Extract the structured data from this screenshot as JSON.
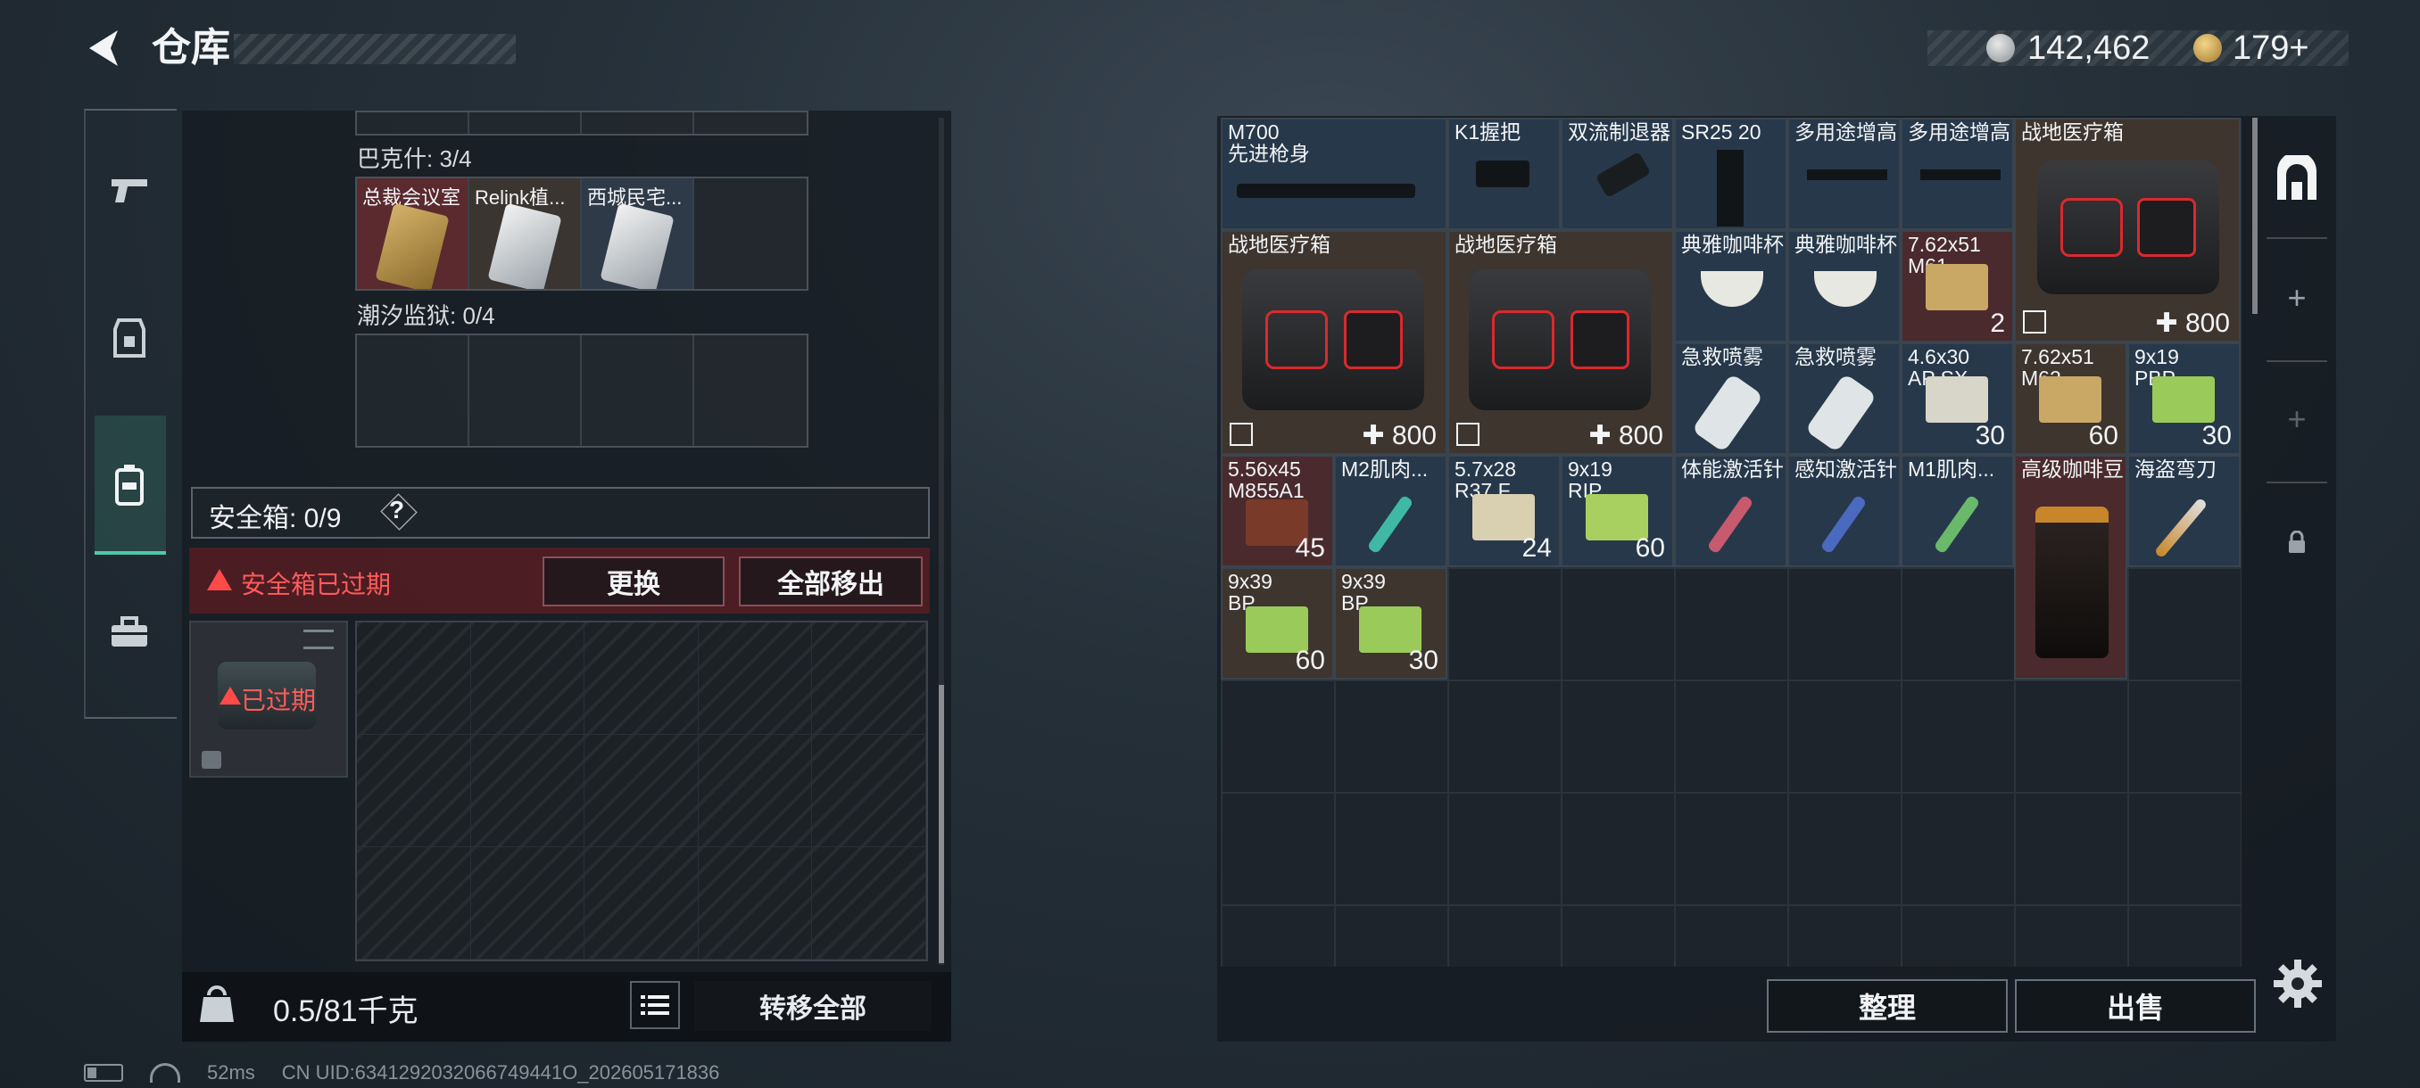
{
  "header": {
    "title": "仓库"
  },
  "currency": {
    "silver": "142,462",
    "gold": "179",
    "gold_plus": "+"
  },
  "left_panel": {
    "bakeshi_label": "巴克什: 3/4",
    "bakeshi_items": [
      "总裁会议室",
      "Relink植...",
      "西城民宅..."
    ],
    "chaoxi_label": "潮汐监狱: 0/4",
    "safe_box_label": "安全箱: 0/9",
    "help": "?",
    "expired_text": "安全箱已过期",
    "replace_btn": "更换",
    "moveall_btn": "全部移出",
    "safe_expired_label": "已过期",
    "weight": "0.5/81千克",
    "transfer_all_btn": "转移全部"
  },
  "status_bar": {
    "ping": "52ms",
    "uid": "CN UID:6341292032066749441O_202605171836"
  },
  "inventory": {
    "items": [
      {
        "name": "M700\n先进枪身"
      },
      {
        "name": "K1握把"
      },
      {
        "name": "双流制退器"
      },
      {
        "name": "SR25 20"
      },
      {
        "name": "多用途增高"
      },
      {
        "name": "多用途增高"
      },
      {
        "name": "战地医疗箱",
        "extra": "800"
      },
      {
        "name": "战地医疗箱",
        "extra": "800"
      },
      {
        "name": "战地医疗箱",
        "extra": "800"
      },
      {
        "name": "典雅咖啡杯"
      },
      {
        "name": "典雅咖啡杯"
      },
      {
        "name": "7.62x51\nM61",
        "qty": "2"
      },
      {
        "name": "急救喷雾"
      },
      {
        "name": "急救喷雾"
      },
      {
        "name": "4.6x30\nAP SX",
        "qty": "30"
      },
      {
        "name": "7.62x51\nM62",
        "qty": "60"
      },
      {
        "name": "9x19\nPBP",
        "qty": "30"
      },
      {
        "name": "5.56x45\nM855A1",
        "qty": "45"
      },
      {
        "name": "M2肌肉..."
      },
      {
        "name": "5.7x28\nR37.F",
        "qty": "24"
      },
      {
        "name": "9x19\nRIP",
        "qty": "60"
      },
      {
        "name": "体能激活针"
      },
      {
        "name": "感知激活针"
      },
      {
        "name": "M1肌肉..."
      },
      {
        "name": "高级咖啡豆"
      },
      {
        "name": "海盗弯刀"
      },
      {
        "name": "9x39\nBP",
        "qty": "60"
      },
      {
        "name": "9x39\nBP",
        "qty": "30"
      }
    ],
    "sort_btn": "整理",
    "sell_btn": "出售"
  },
  "colors": {
    "accent": "#4fc9a6",
    "warning": "#ff5b5b",
    "item_blue": "#27384a",
    "item_brown": "#3e352f"
  }
}
